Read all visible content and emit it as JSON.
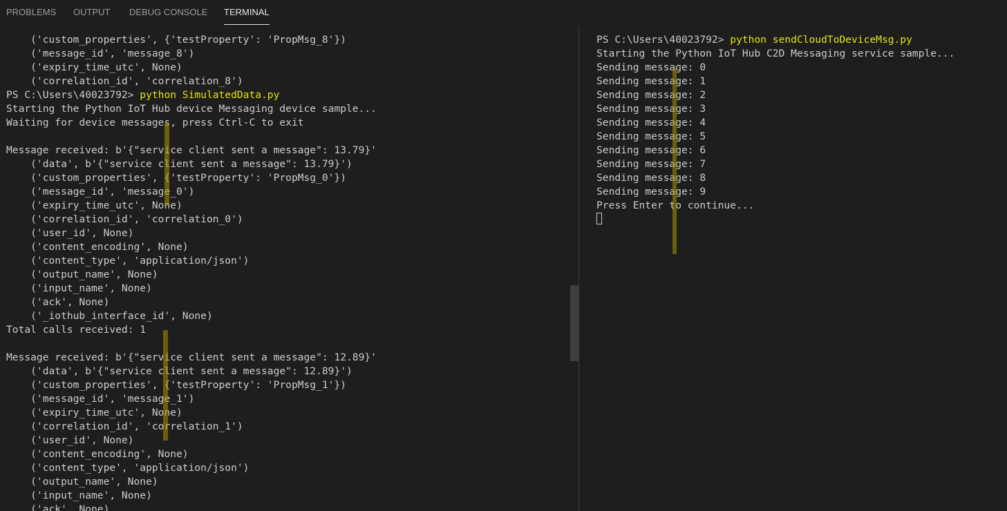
{
  "panel": {
    "tabs": [
      {
        "label": "PROBLEMS"
      },
      {
        "label": "OUTPUT"
      },
      {
        "label": "DEBUG CONSOLE"
      },
      {
        "label": "TERMINAL"
      }
    ],
    "active_tab": "TERMINAL"
  },
  "terminal_left": {
    "lines": [
      "    ('custom_properties', {'testProperty': 'PropMsg_8'})",
      "    ('message_id', 'message_8')",
      "    ('expiry_time_utc', None)",
      "    ('correlation_id', 'correlation_8')",
      "PS C:\\Users\\40023792> ",
      "Starting the Python IoT Hub device Messaging device sample...",
      "Waiting for device messages, press Ctrl-C to exit",
      "",
      "Message received: b'{\"service client sent a message\": 13.79}'",
      "    ('data', b'{\"service client sent a message\": 13.79}')",
      "    ('custom_properties', {'testProperty': 'PropMsg_0'})",
      "    ('message_id', 'message_0')",
      "    ('expiry_time_utc', None)",
      "    ('correlation_id', 'correlation_0')",
      "    ('user_id', None)",
      "    ('content_encoding', None)",
      "    ('content_type', 'application/json')",
      "    ('output_name', None)",
      "    ('input_name', None)",
      "    ('ack', None)",
      "    ('_iothub_interface_id', None)",
      "Total calls received: 1",
      "",
      "Message received: b'{\"service client sent a message\": 12.89}'",
      "    ('data', b'{\"service client sent a message\": 12.89}')",
      "    ('custom_properties', {'testProperty': 'PropMsg_1'})",
      "    ('message_id', 'message_1')",
      "    ('expiry_time_utc', None)",
      "    ('correlation_id', 'correlation_1')",
      "    ('user_id', None)",
      "    ('content_encoding', None)",
      "    ('content_type', 'application/json')",
      "    ('output_name', None)",
      "    ('input_name', None)",
      "    ('ack', None)"
    ],
    "command": "python SimulatedData.py",
    "command_line_index": 4
  },
  "terminal_right": {
    "lines": [
      "PS C:\\Users\\40023792> ",
      "Starting the Python IoT Hub C2D Messaging service sample...",
      "Sending message: 0",
      "Sending message: 1",
      "Sending message: 2",
      "Sending message: 3",
      "Sending message: 4",
      "Sending message: 5",
      "Sending message: 6",
      "Sending message: 7",
      "Sending message: 8",
      "Sending message: 9",
      "Press Enter to continue..."
    ],
    "command": "python sendCloudToDeviceMsg.py",
    "command_line_index": 0
  },
  "colors": {
    "background": "#1e1e1e",
    "text": "#cccccc",
    "command": "#e5e510",
    "tab_active": "#e7e7e7",
    "tab_inactive": "#9d9d9d"
  }
}
